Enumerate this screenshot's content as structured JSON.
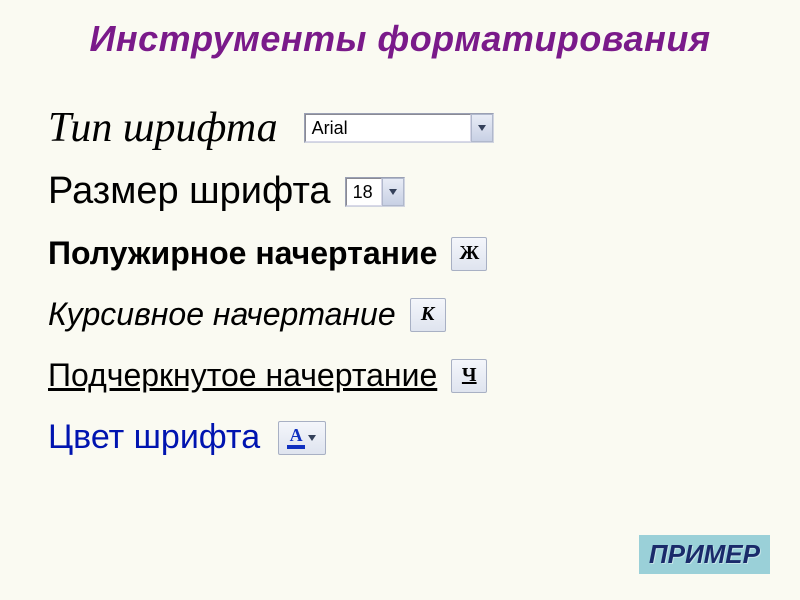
{
  "title": "Инструменты форматирования",
  "rows": {
    "font_type": {
      "label": "Тип шрифта",
      "value": "Arial"
    },
    "font_size": {
      "label": "Размер шрифта",
      "value": "18"
    },
    "bold": {
      "label": "Полужирное начертание",
      "glyph": "Ж"
    },
    "italic": {
      "label": "Курсивное начертание",
      "glyph": "К"
    },
    "underline": {
      "label": "Подчеркнутое начертание",
      "glyph": "Ч"
    },
    "color": {
      "label": "Цвет шрифта",
      "glyph": "А",
      "swatch": "#1030c0"
    }
  },
  "example_button": "ПРИМЕР"
}
